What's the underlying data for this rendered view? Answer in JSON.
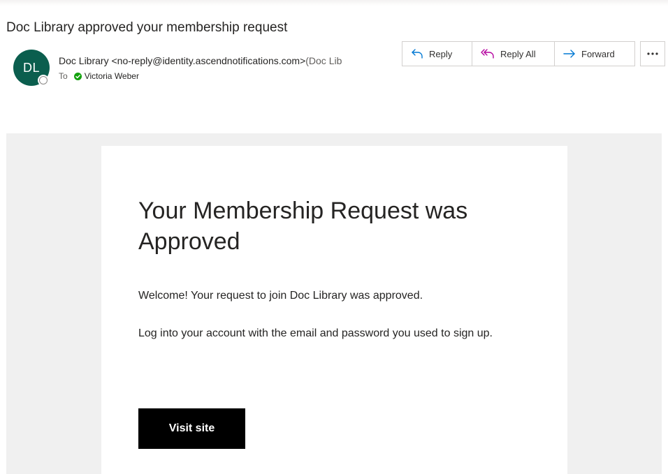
{
  "message": {
    "subject": "Doc Library approved your membership request",
    "avatar_initials": "DL",
    "sender_name": "Doc Library",
    "sender_address": "<no-reply@identity.ascendnotifications.com>",
    "sender_address_extra": "(Doc Lib",
    "to_label": "To",
    "recipient": "Victoria Weber"
  },
  "actions": {
    "reply": "Reply",
    "reply_all": "Reply All",
    "forward": "Forward",
    "more": "···"
  },
  "email_body": {
    "title": "Your Membership Request was Approved",
    "paragraph1": "Welcome! Your request to join Doc Library was approved.",
    "paragraph2": "Log into your account with the email and password you used to sign up.",
    "button_label": "Visit site"
  },
  "colors": {
    "avatar_bg": "#0b5e4e",
    "reply_icon": "#0078d4",
    "reply_all_icon": "#b4009e",
    "forward_icon": "#0078d4",
    "verified_check": "#13a10e",
    "button_bg": "#000000"
  },
  "icons": {
    "reply": "reply-arrow-icon",
    "reply_all": "reply-all-arrow-icon",
    "forward": "forward-arrow-icon",
    "more": "more-dots-icon",
    "verified": "verified-check-icon",
    "presence": "presence-status-icon"
  }
}
